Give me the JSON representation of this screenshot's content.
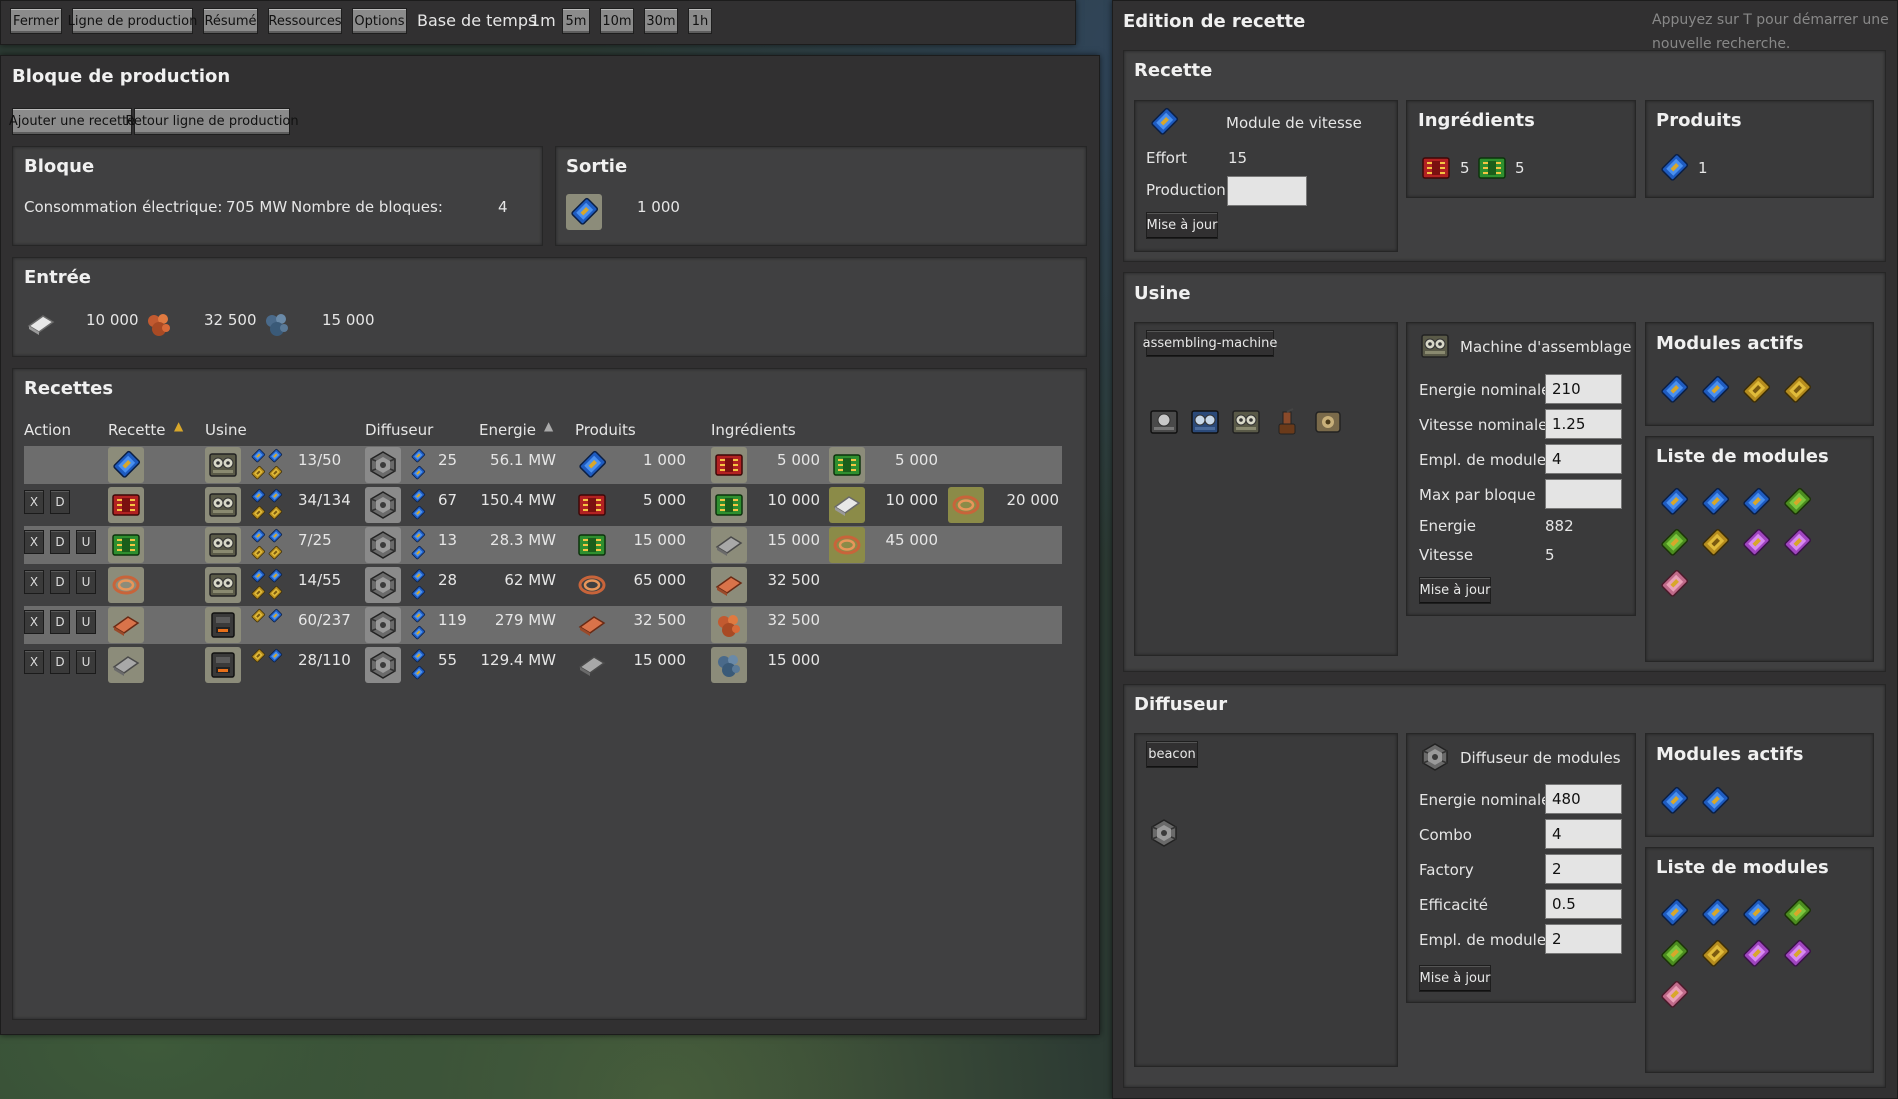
{
  "toolbar": {
    "close": "Fermer",
    "line": "Ligne de production",
    "summary": "Résumé",
    "resources": "Ressources",
    "options": "Options",
    "timebase_label": "Base de temps",
    "timebase_value": "1m",
    "t5m": "5m",
    "t10m": "10m",
    "t30m": "30m",
    "t1h": "1h"
  },
  "block": {
    "title": "Bloque de production",
    "add_recipe": "Ajouter une recette",
    "back_line": "Retour ligne de production",
    "bloc_title": "Bloque",
    "power_label": "Consommation électrique:",
    "power_value": "705 MW",
    "count_label": "Nombre de bloques:",
    "count_value": "4",
    "output_title": "Sortie",
    "output_value": "1 000",
    "input_title": "Entrée",
    "inputs": [
      "10 000",
      "32 500",
      "15 000"
    ]
  },
  "recipes": {
    "title": "Recettes",
    "headers": [
      "Action",
      "Recette",
      "Usine",
      "Diffuseur",
      "Energie",
      "Produits",
      "Ingrédients"
    ],
    "rows": [
      {
        "actions": [],
        "factory_count": "13/50",
        "beacon_count": "25",
        "energy": "56.1 MW",
        "product": "1 000",
        "ing1": "5 000",
        "ing2": "5 000",
        "ing3": ""
      },
      {
        "actions": [
          "X",
          "D"
        ],
        "factory_count": "34/134",
        "beacon_count": "67",
        "energy": "150.4 MW",
        "product": "5 000",
        "ing1": "10 000",
        "ing2": "10 000",
        "ing3": "20 000"
      },
      {
        "actions": [
          "X",
          "D",
          "U"
        ],
        "factory_count": "7/25",
        "beacon_count": "13",
        "energy": "28.3 MW",
        "product": "15 000",
        "ing1": "15 000",
        "ing2": "45 000",
        "ing3": ""
      },
      {
        "actions": [
          "X",
          "D",
          "U"
        ],
        "factory_count": "14/55",
        "beacon_count": "28",
        "energy": "62 MW",
        "product": "65 000",
        "ing1": "32 500",
        "ing2": "",
        "ing3": ""
      },
      {
        "actions": [
          "X",
          "D",
          "U"
        ],
        "factory_count": "60/237",
        "beacon_count": "119",
        "energy": "279 MW",
        "product": "32 500",
        "ing1": "32 500",
        "ing2": "",
        "ing3": ""
      },
      {
        "actions": [
          "X",
          "D",
          "U"
        ],
        "factory_count": "28/110",
        "beacon_count": "55",
        "energy": "129.4 MW",
        "product": "15 000",
        "ing1": "15 000",
        "ing2": "",
        "ing3": ""
      }
    ]
  },
  "editor": {
    "title": "Edition de recette",
    "hint": "Appuyez sur T pour démarrer une nouvelle recherche.",
    "recipe_title": "Recette",
    "recipe_name": "Module de vitesse",
    "effort_label": "Effort",
    "effort_value": "15",
    "production_label": "Production",
    "production_value": "",
    "update": "Mise à jour",
    "ingredients_title": "Ingrédients",
    "ing_a": "5",
    "ing_b": "5",
    "products_title": "Produits",
    "prod_a": "1",
    "factory_title": "Usine",
    "factory_btn": "assembling-machine",
    "machine_name": "Machine d'assemblage très",
    "energy_nominal_label": "Energie nominale",
    "energy_nominal": "210",
    "speed_nominal_label": "Vitesse nominale",
    "speed_nominal": "1.25",
    "module_slots_label": "Empl. de module",
    "module_slots": "4",
    "max_per_block_label": "Max par bloque",
    "max_per_block": "",
    "energy_label": "Energie",
    "energy_value": "882",
    "speed_label": "Vitesse",
    "speed_value": "5",
    "active_modules": "Modules actifs",
    "module_list": "Liste de modules",
    "beacon_title": "Diffuseur",
    "beacon_btn": "beacon",
    "beacon_name": "Diffuseur de modules",
    "b_energy_label": "Energie nominale",
    "b_energy": "480",
    "combo_label": "Combo",
    "combo": "4",
    "factory_label": "Factory",
    "factory": "2",
    "efficiency_label": "Efficacité",
    "efficiency": "0.5",
    "b_slots_label": "Empl. de module",
    "b_slots": "2"
  },
  "colors": {
    "module_speed": "#2a6fd6",
    "module_prod": "#c9a62a",
    "module_eff": "#5aa02a",
    "circuit_red": "#c0282a",
    "circuit_green": "#3aa03a"
  }
}
